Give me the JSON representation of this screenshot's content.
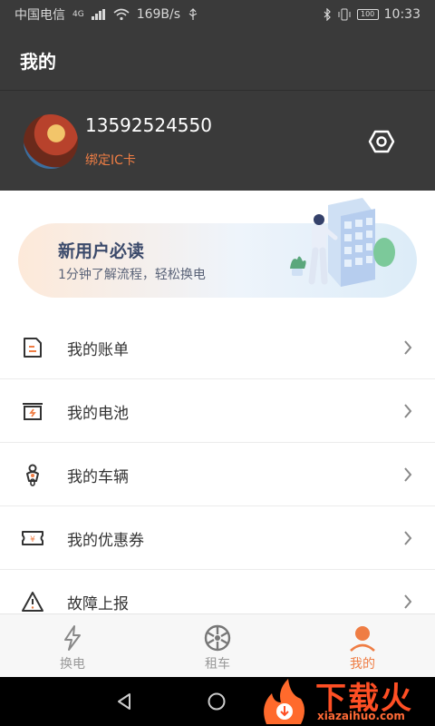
{
  "status_bar": {
    "carrier": "中国电信",
    "network": "4G",
    "speed": "169B/s",
    "battery": "100",
    "time": "10:33"
  },
  "header": {
    "title": "我的"
  },
  "profile": {
    "phone": "13592524550",
    "bind_card_label": "绑定IC卡",
    "settings_icon": "hexagon-nut-icon"
  },
  "banner": {
    "title": "新用户必读",
    "subtitle": "1分钟了解流程，轻松换电"
  },
  "menu": {
    "items": [
      {
        "label": "我的账单",
        "icon": "bill-icon"
      },
      {
        "label": "我的电池",
        "icon": "battery-icon"
      },
      {
        "label": "我的车辆",
        "icon": "scooter-icon"
      },
      {
        "label": "我的优惠券",
        "icon": "coupon-icon"
      },
      {
        "label": "故障上报",
        "icon": "warning-icon"
      }
    ]
  },
  "tabs": [
    {
      "label": "换电",
      "icon": "lightning-icon",
      "active": false
    },
    {
      "label": "租车",
      "icon": "wheel-icon",
      "active": false
    },
    {
      "label": "我的",
      "icon": "person-icon",
      "active": true
    }
  ],
  "watermark": {
    "brand": "下载火",
    "domain": "xiazaihuo.com"
  },
  "colors": {
    "header_bg": "#3a3a3a",
    "accent": "#ef7d44",
    "tab_inactive": "#999999"
  }
}
